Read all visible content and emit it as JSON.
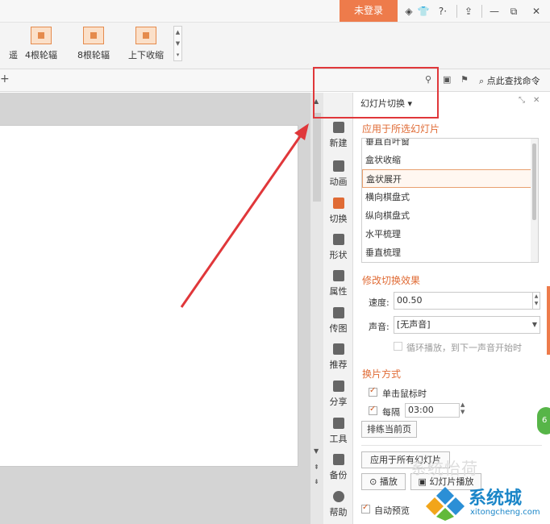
{
  "titlebar": {
    "login": "未登录",
    "icons": [
      "skin-icon",
      "shirt-icon",
      "help-icon",
      "upload-icon",
      "minimize-icon",
      "restore-icon",
      "close-icon"
    ],
    "help_label": "?·"
  },
  "ribbon": {
    "partial_label": "遥",
    "effects": [
      {
        "label": "4根轮辐"
      },
      {
        "label": "8根轮辐"
      },
      {
        "label": "上下收缩"
      }
    ]
  },
  "toolrow": {
    "search_label": "点此查找命令"
  },
  "sidetabs": [
    {
      "label": "新建",
      "icon": "new-icon"
    },
    {
      "label": "动画",
      "icon": "animation-icon"
    },
    {
      "label": "切换",
      "icon": "transition-icon",
      "active": true
    },
    {
      "label": "形状",
      "icon": "shape-icon"
    },
    {
      "label": "属性",
      "icon": "properties-icon"
    },
    {
      "label": "传图",
      "icon": "upload-image-icon"
    },
    {
      "label": "推荐",
      "icon": "recommend-icon"
    },
    {
      "label": "分享",
      "icon": "share-icon"
    },
    {
      "label": "工具",
      "icon": "tools-icon"
    },
    {
      "label": "备份",
      "icon": "backup-icon"
    },
    {
      "label": "帮助",
      "icon": "help-icon"
    }
  ],
  "panel": {
    "title": "幻灯片切换 ▾",
    "apply_section": "应用于所选幻灯片",
    "transitions": [
      "垂直百叶窗",
      "盒状收缩",
      "盒状展开",
      "横向棋盘式",
      "纵向棋盘式",
      "水平梳理",
      "垂直梳理"
    ],
    "selected_transition": "盒状展开",
    "modify_section": "修改切换效果",
    "speed_label": "速度:",
    "speed_value": "00.50",
    "sound_label": "声音:",
    "sound_value": "[无声音]",
    "loop_label": "循环播放，到下一声音开始时",
    "advance_section": "换片方式",
    "on_click_label": "单击鼠标时",
    "every_label": "每隔",
    "every_value": "03:00",
    "rehearse_label": "排练当前页",
    "apply_all_label": "应用于所有幻灯片",
    "play_label": "播放",
    "slideshow_label": "幻灯片播放",
    "autopreview_label": "自动预览"
  },
  "watermark": "系统怡荷",
  "logo": {
    "text": "系统城",
    "url": "xitongcheng.com"
  },
  "green_badge": "6",
  "colors": {
    "accent": "#e06b35",
    "login": "#ee7b4b",
    "annotation": "#e0373a"
  }
}
